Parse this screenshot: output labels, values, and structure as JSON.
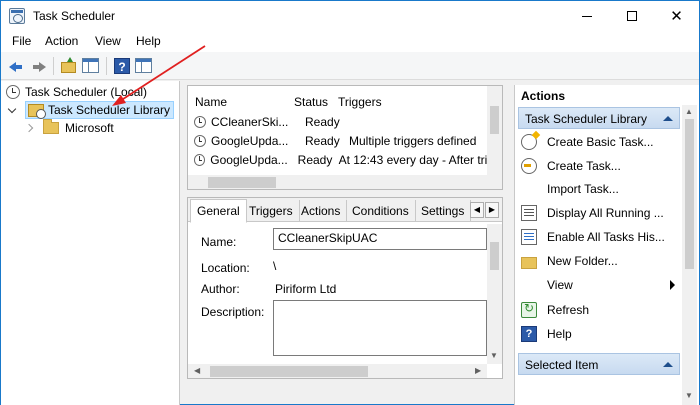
{
  "window": {
    "title": "Task Scheduler"
  },
  "menu": [
    "File",
    "Action",
    "View",
    "Help"
  ],
  "tree": {
    "root": "Task Scheduler (Local)",
    "library": "Task Scheduler Library",
    "child": "Microsoft"
  },
  "task_list": {
    "columns": [
      "Name",
      "Status",
      "Triggers"
    ],
    "rows": [
      {
        "name": "CCleanerSki...",
        "status": "Ready",
        "triggers": ""
      },
      {
        "name": "GoogleUpda...",
        "status": "Ready",
        "triggers": "Multiple triggers defined"
      },
      {
        "name": "GoogleUpda...",
        "status": "Ready",
        "triggers": "At 12:43 every day - After trig"
      }
    ]
  },
  "detail": {
    "tabs": [
      "General",
      "Triggers",
      "Actions",
      "Conditions",
      "Settings"
    ],
    "name_label": "Name:",
    "name_value": "CCleanerSkipUAC",
    "location_label": "Location:",
    "location_value": "\\",
    "author_label": "Author:",
    "author_value": "Piriform Ltd",
    "description_label": "Description:"
  },
  "actions": {
    "title": "Actions",
    "section1": "Task Scheduler Library",
    "items": [
      {
        "label": "Create Basic Task...",
        "icon": "create-basic-task-icon"
      },
      {
        "label": "Create Task...",
        "icon": "create-task-icon"
      },
      {
        "label": "Import Task...",
        "icon": ""
      },
      {
        "label": "Display All Running ...",
        "icon": "display-running-icon"
      },
      {
        "label": "Enable All Tasks His...",
        "icon": "enable-history-icon"
      },
      {
        "label": "New Folder...",
        "icon": "folder-icon"
      },
      {
        "label": "View",
        "icon": ""
      },
      {
        "label": "Refresh",
        "icon": "refresh-icon"
      },
      {
        "label": "Help",
        "icon": "help-icon"
      }
    ],
    "section2": "Selected Item"
  },
  "colors": {
    "accent": "#1979ca",
    "selection": "#cce8ff",
    "annotation_arrow": "#e02020"
  }
}
